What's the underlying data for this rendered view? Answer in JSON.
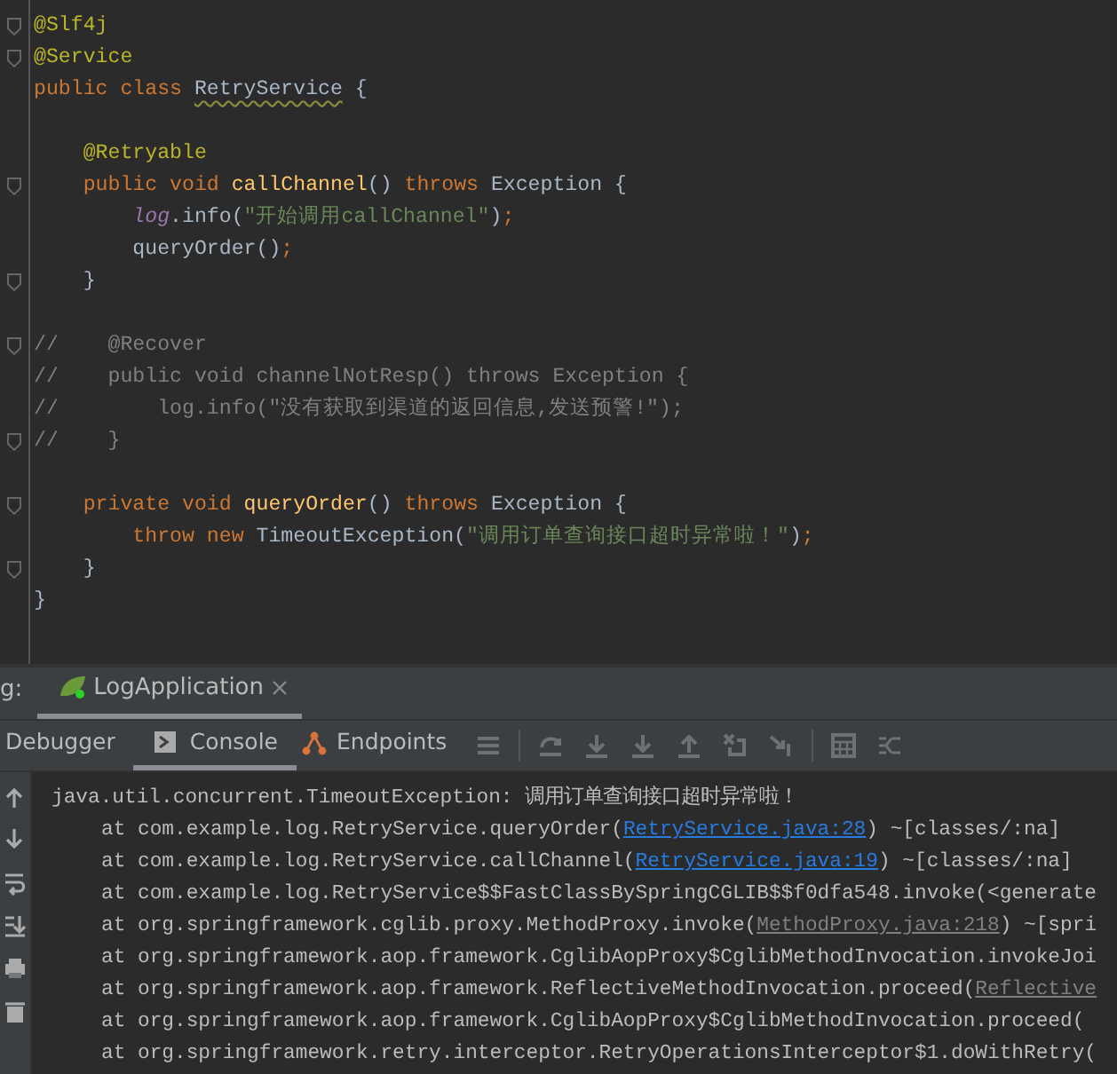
{
  "editor": {
    "lines": [
      {
        "fold": true,
        "tokens": [
          {
            "kind": "annotation",
            "text": "@Slf4j"
          }
        ]
      },
      {
        "fold": true,
        "tokens": [
          {
            "kind": "annotation",
            "text": "@Service"
          }
        ]
      },
      {
        "fold": false,
        "tokens": [
          {
            "kind": "keyword",
            "text": "public class "
          },
          {
            "kind": "class-warn",
            "text": "RetryService"
          },
          {
            "kind": "plain",
            "text": " {"
          }
        ]
      },
      {
        "fold": false
      },
      {
        "fold": false,
        "tokens": [
          {
            "kind": "annotation",
            "text": "    @Retryable"
          }
        ]
      },
      {
        "fold": true,
        "tokens": [
          {
            "kind": "keyword",
            "text": "    public void "
          },
          {
            "kind": "method",
            "text": "callChannel"
          },
          {
            "kind": "plain",
            "text": "() "
          },
          {
            "kind": "keyword",
            "text": "throws "
          },
          {
            "kind": "plain",
            "text": "Exception {"
          }
        ]
      },
      {
        "fold": false,
        "tokens": [
          {
            "kind": "field",
            "text": "        log"
          },
          {
            "kind": "plain",
            "text": ".info("
          },
          {
            "kind": "string",
            "text": "\"开始调用callChannel\""
          },
          {
            "kind": "plain",
            "text": ")"
          },
          {
            "kind": "keyword",
            "text": ";"
          }
        ]
      },
      {
        "fold": false,
        "tokens": [
          {
            "kind": "plain",
            "text": "        queryOrder()"
          },
          {
            "kind": "keyword",
            "text": ";"
          }
        ]
      },
      {
        "fold": true,
        "tokens": [
          {
            "kind": "plain",
            "text": "    }"
          }
        ]
      },
      {
        "fold": false
      },
      {
        "fold": true,
        "tokens": [
          {
            "kind": "comment",
            "text": "//    @Recover"
          }
        ]
      },
      {
        "fold": false,
        "tokens": [
          {
            "kind": "comment",
            "text": "//    public void channelNotResp() throws Exception {"
          }
        ]
      },
      {
        "fold": false,
        "tokens": [
          {
            "kind": "comment",
            "text": "//        log.info(\"没有获取到渠道的返回信息,发送预警!\");"
          }
        ]
      },
      {
        "fold": true,
        "tokens": [
          {
            "kind": "comment",
            "text": "//    }"
          }
        ]
      },
      {
        "fold": false
      },
      {
        "fold": true,
        "tokens": [
          {
            "kind": "keyword",
            "text": "    private void "
          },
          {
            "kind": "method",
            "text": "queryOrder"
          },
          {
            "kind": "plain",
            "text": "() "
          },
          {
            "kind": "keyword",
            "text": "throws "
          },
          {
            "kind": "plain",
            "text": "Exception {"
          }
        ]
      },
      {
        "fold": false,
        "tokens": [
          {
            "kind": "keyword",
            "text": "        throw new "
          },
          {
            "kind": "plain",
            "text": "TimeoutException("
          },
          {
            "kind": "string",
            "text": "\"调用订单查询接口超时异常啦！\""
          },
          {
            "kind": "plain",
            "text": ")"
          },
          {
            "kind": "keyword",
            "text": ";"
          }
        ]
      },
      {
        "fold": true,
        "tokens": [
          {
            "kind": "plain",
            "text": "    }"
          }
        ]
      },
      {
        "fold": false,
        "tokens": [
          {
            "kind": "plain",
            "text": "}"
          }
        ]
      }
    ]
  },
  "run_bar": {
    "label": "g:",
    "tabs": [
      {
        "label": "LogApplication",
        "selected": true
      }
    ]
  },
  "console_tabs": [
    {
      "label": "Debugger",
      "kind": "plain",
      "selected": false
    },
    {
      "label": "Console",
      "kind": "console",
      "selected": true
    },
    {
      "label": "Endpoints",
      "kind": "endpoints",
      "selected": false
    }
  ],
  "console": {
    "lines": [
      {
        "indent": false,
        "tokens": [
          {
            "kind": "plain",
            "text": "java.util.concurrent.TimeoutException: 调用订单查询接口超时异常啦！"
          }
        ]
      },
      {
        "indent": true,
        "tokens": [
          {
            "kind": "plain",
            "text": "at com.example.log.RetryService.queryOrder("
          },
          {
            "kind": "link",
            "text": "RetryService.java:28"
          },
          {
            "kind": "plain",
            "text": ") ~[classes/:na]"
          }
        ]
      },
      {
        "indent": true,
        "tokens": [
          {
            "kind": "plain",
            "text": "at com.example.log.RetryService.callChannel("
          },
          {
            "kind": "link",
            "text": "RetryService.java:19"
          },
          {
            "kind": "plain",
            "text": ") ~[classes/:na]"
          }
        ]
      },
      {
        "indent": true,
        "tokens": [
          {
            "kind": "plain",
            "text": "at com.example.log.RetryService$$FastClassBySpringCGLIB$$f0dfa548.invoke(<generate"
          }
        ]
      },
      {
        "indent": true,
        "tokens": [
          {
            "kind": "plain",
            "text": "at org.springframework.cglib.proxy.MethodProxy.invoke("
          },
          {
            "kind": "lib-link",
            "text": "MethodProxy.java:218"
          },
          {
            "kind": "plain",
            "text": ") ~[spri"
          }
        ]
      },
      {
        "indent": true,
        "tokens": [
          {
            "kind": "plain",
            "text": "at org.springframework.aop.framework.CglibAopProxy$CglibMethodInvocation.invokeJoi"
          }
        ]
      },
      {
        "indent": true,
        "tokens": [
          {
            "kind": "plain",
            "text": "at org.springframework.aop.framework.ReflectiveMethodInvocation.proceed("
          },
          {
            "kind": "lib-link",
            "text": "Reflective"
          }
        ]
      },
      {
        "indent": true,
        "tokens": [
          {
            "kind": "plain",
            "text": "at org.springframework.aop.framework.CglibAopProxy$CglibMethodInvocation.proceed("
          }
        ]
      },
      {
        "indent": true,
        "tokens": [
          {
            "kind": "plain",
            "text": "at org.springframework.retry.interceptor.RetryOperationsInterceptor$1.doWithRetry("
          }
        ]
      }
    ]
  }
}
